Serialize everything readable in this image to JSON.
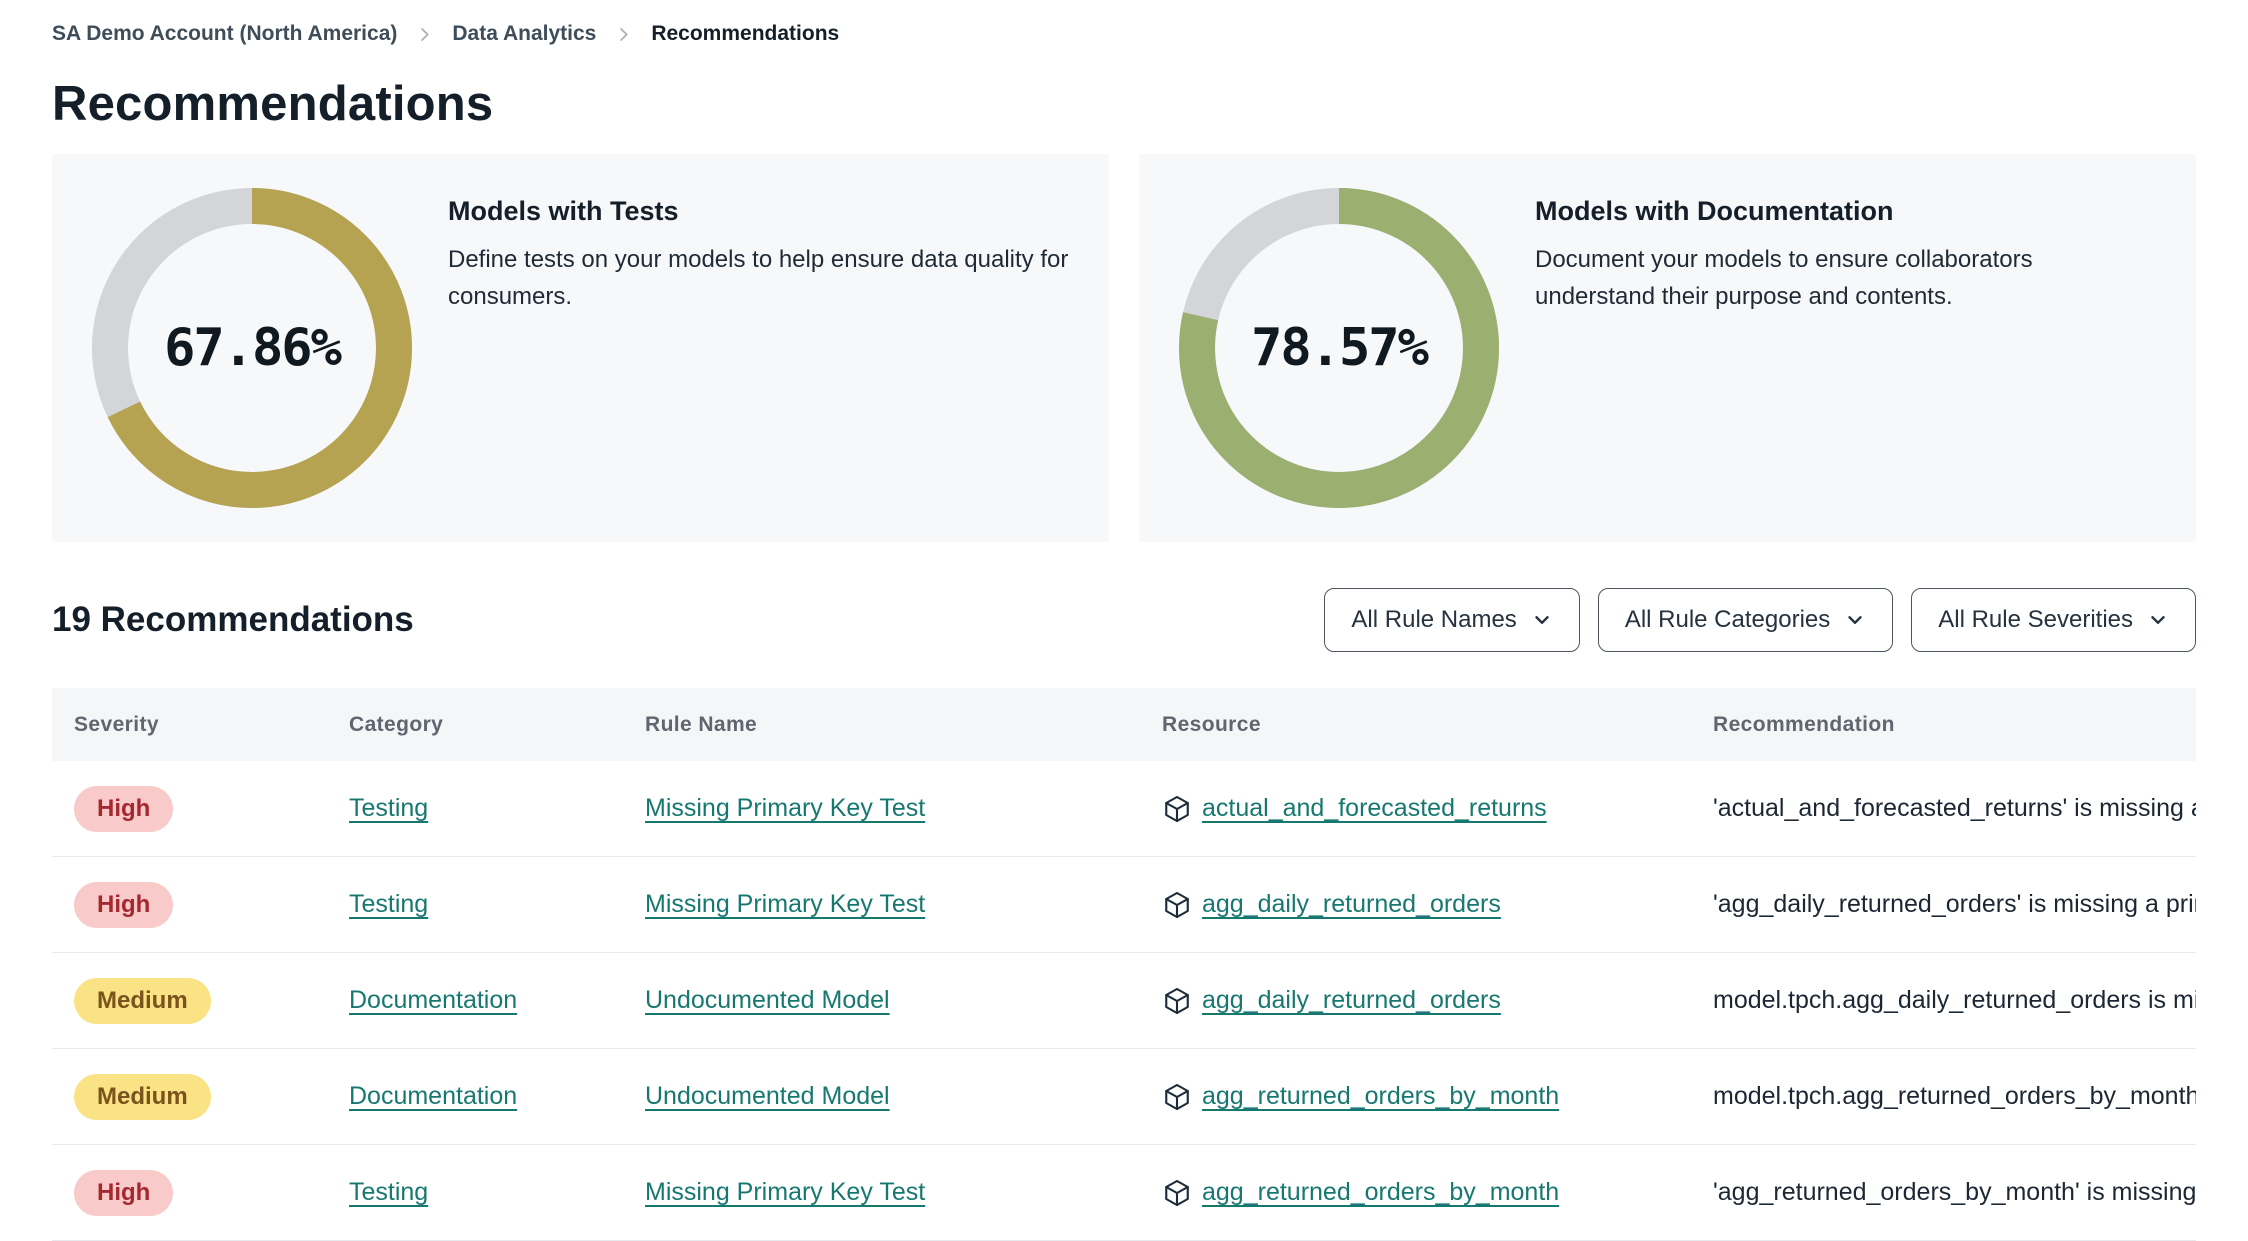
{
  "breadcrumb": {
    "items": [
      {
        "label": "SA Demo Account (North America)",
        "current": false
      },
      {
        "label": "Data Analytics",
        "current": false
      },
      {
        "label": "Recommendations",
        "current": true
      }
    ]
  },
  "page": {
    "title": "Recommendations"
  },
  "summary_cards": [
    {
      "title": "Models with Tests",
      "description": "Define tests on your models to help ensure data quality for consumers.",
      "percent": 67.86,
      "percent_label": "67.86%",
      "arc_color": "#b5a351",
      "track_color": "#d4d5d8"
    },
    {
      "title": "Models with Documentation",
      "description": "Document your models to ensure collaborators understand their purpose and contents.",
      "percent": 78.57,
      "percent_label": "78.57%",
      "arc_color": "#9baf70",
      "track_color": "#d4d5d8"
    }
  ],
  "list_header": {
    "count_label": "19 Recommendations",
    "filters": [
      {
        "label": "All Rule Names"
      },
      {
        "label": "All Rule Categories"
      },
      {
        "label": "All Rule Severities"
      }
    ]
  },
  "table": {
    "columns": [
      "Severity",
      "Category",
      "Rule Name",
      "Resource",
      "Recommendation"
    ],
    "rows": [
      {
        "severity": "High",
        "severity_level": "high",
        "category": "Testing",
        "rule_name": "Missing Primary Key Test",
        "resource": "actual_and_forecasted_returns",
        "recommendation": "'actual_and_forecasted_returns' is missing a …"
      },
      {
        "severity": "High",
        "severity_level": "high",
        "category": "Testing",
        "rule_name": "Missing Primary Key Test",
        "resource": "agg_daily_returned_orders",
        "recommendation": "'agg_daily_returned_orders' is missing a prim…"
      },
      {
        "severity": "Medium",
        "severity_level": "medium",
        "category": "Documentation",
        "rule_name": "Undocumented Model",
        "resource": "agg_daily_returned_orders",
        "recommendation": "model.tpch.agg_daily_returned_orders is mis…"
      },
      {
        "severity": "Medium",
        "severity_level": "medium",
        "category": "Documentation",
        "rule_name": "Undocumented Model",
        "resource": "agg_returned_orders_by_month",
        "recommendation": "model.tpch.agg_returned_orders_by_month …"
      },
      {
        "severity": "High",
        "severity_level": "high",
        "category": "Testing",
        "rule_name": "Missing Primary Key Test",
        "resource": "agg_returned_orders_by_month",
        "recommendation": "'agg_returned_orders_by_month' is missing …"
      }
    ]
  },
  "colors": {
    "accent_teal_link": "#17786f",
    "badge_high_bg": "#f8caca",
    "badge_high_text": "#a3292e",
    "badge_medium_bg": "#f9e385",
    "badge_medium_text": "#7a531d",
    "gauge_tests": "#b5a351",
    "gauge_docs": "#9baf70",
    "gauge_track": "#d4d5d8"
  }
}
